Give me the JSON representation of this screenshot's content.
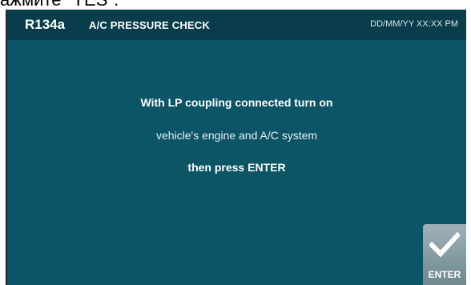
{
  "caption": "ажмите \"YES\".",
  "header": {
    "refrigerant": "R134a",
    "title": "A/C PRESSURE CHECK",
    "datetime": "DD/MM/YY XX:XX PM"
  },
  "message": {
    "line1": "With LP coupling connected turn on",
    "line2": "vehicle's engine and A/C system",
    "line3": "then press ENTER"
  },
  "enter_button": {
    "label": "ENTER",
    "icon": "checkmark-icon"
  },
  "colors": {
    "screen_bg": "#0c5566",
    "header_bg": "#0a3d4b",
    "button_bg": "#8aa0a7"
  }
}
